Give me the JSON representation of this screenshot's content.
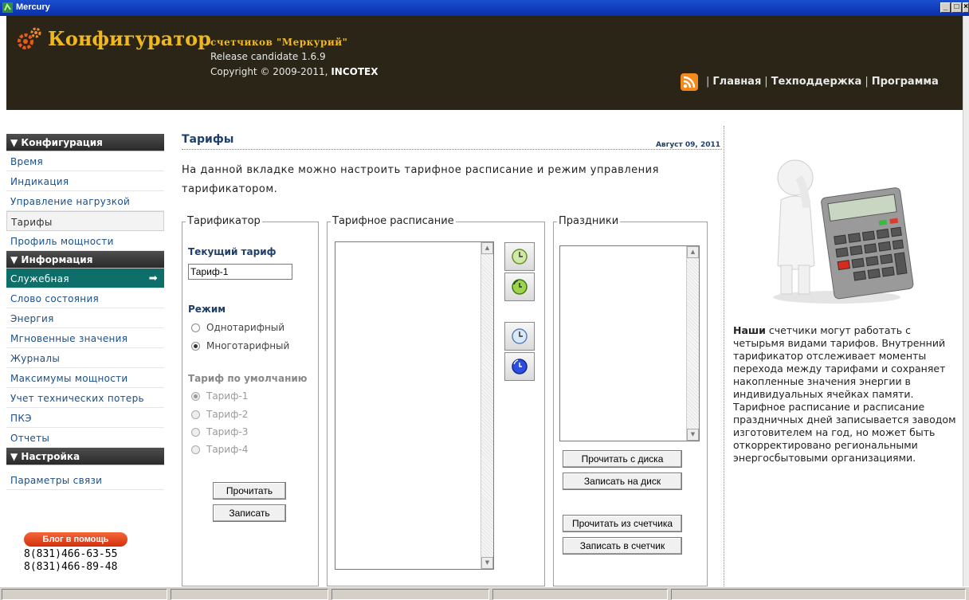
{
  "window": {
    "title": "Mercury"
  },
  "header": {
    "brand": "Конфигуратор",
    "subtitle": "счетчиков \"Меркурий\"",
    "release": "Release candidate 1.6.9",
    "copyright_prefix": "Copyright © 2009-2011, ",
    "copyright_company": "INCOTEX",
    "nav": [
      "Главная",
      "Техподдержка",
      "Программа"
    ]
  },
  "sidebar": {
    "sections": [
      {
        "title": "▼ Конфигурация",
        "items": [
          "Время",
          "Индикация",
          "Управление нагрузкой",
          "Тарифы",
          "Профиль мощности"
        ]
      },
      {
        "title": "▼ Информация",
        "items": [
          "Служебная",
          "Слово состояния",
          "Энергия",
          "Мгновенные значения",
          "Журналы",
          "Максимумы мощности",
          "Учет технических потерь",
          "ПКЭ",
          "Отчеты"
        ]
      },
      {
        "title": "▼ Настройка",
        "items": [
          "Параметры связи"
        ]
      }
    ],
    "blog_label": "Блог в помощь",
    "phones": [
      "8(831)466-63-55",
      "8(831)466-89-48"
    ]
  },
  "main": {
    "title": "Тарифы",
    "date": "Август 09, 2011",
    "intro": "На данной вкладке можно настроить тарифное расписание и режим управления тарификатором.",
    "tarifikator": {
      "legend": "Тарификатор",
      "current_label": "Текущий тариф",
      "current_value": "Тариф-1",
      "mode_label": "Режим",
      "modes": [
        "Однотарифный",
        "Многотарифный"
      ],
      "mode_selected": "Многотарифный",
      "default_label": "Тариф по умолчанию",
      "defaults": [
        "Тариф-1",
        "Тариф-2",
        "Тариф-3",
        "Тариф-4"
      ],
      "default_selected": "Тариф-1",
      "read_btn": "Прочитать",
      "write_btn": "Записать"
    },
    "schedule": {
      "legend": "Тарифное расписание"
    },
    "holidays": {
      "legend": "Праздники",
      "read_disk": "Прочитать с диска",
      "write_disk": "Записать на диск",
      "read_meter": "Прочитать из счетчика",
      "write_meter": "Записать в счетчик"
    }
  },
  "right": {
    "text_bold": "Наши",
    "text": " счетчики могут работать с четырьмя видами тарифов. Внутренний тарификатор отслеживает моменты перехода между тарифами и сохраняет накопленные значения энергии в индивидуальных ячейках памяти. Тарифное расписание и расписание праздничных дней записывается заводом изготовителем на год, но может быть откорректировано региональными энергосбытовыми организациями."
  },
  "colors": {
    "header_bg": "#2a2517",
    "brand_gold": "#f0b81e",
    "active_item": "#0e6e6a",
    "link_blue": "#1b4f8a"
  }
}
